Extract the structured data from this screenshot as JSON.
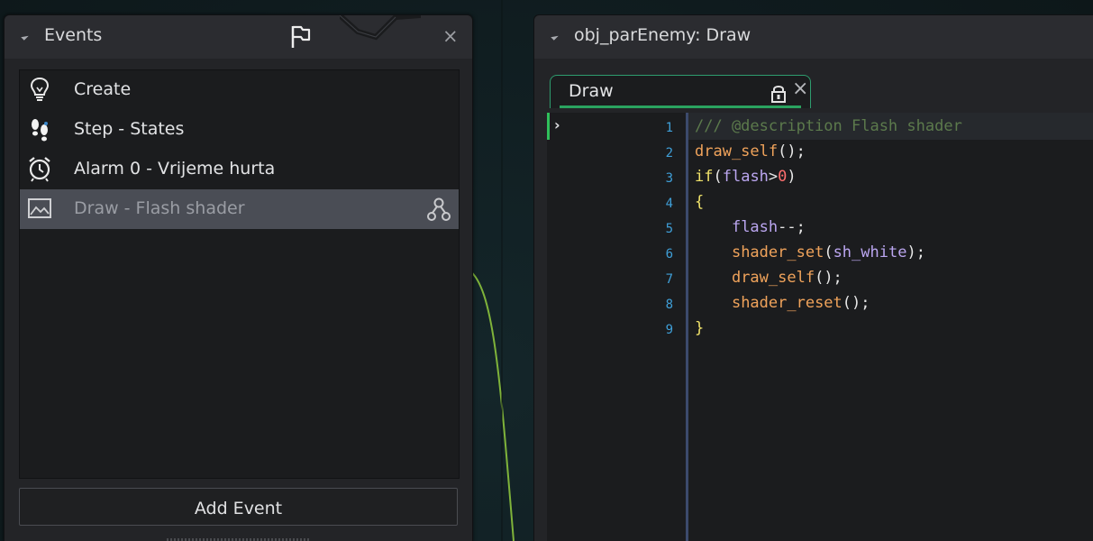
{
  "events_panel": {
    "title": "Events",
    "close_glyph": "×",
    "events": [
      {
        "label": "Create",
        "icon": "lightbulb-icon"
      },
      {
        "label": "Step - States",
        "icon": "footsteps-icon"
      },
      {
        "label": "Alarm 0 - Vrijeme hurta",
        "icon": "alarm-clock-icon"
      },
      {
        "label": "Draw - Flash shader",
        "icon": "picture-icon",
        "selected": true,
        "inherited": true
      }
    ],
    "add_event_label": "Add Event"
  },
  "code_panel": {
    "title": "obj_parEnemy: Draw",
    "tab": {
      "label": "Draw",
      "close_glyph": "×"
    },
    "run_marker": "›",
    "line_numbers": [
      "1",
      "2",
      "3",
      "4",
      "5",
      "6",
      "7",
      "8",
      "9"
    ],
    "lines": [
      [
        {
          "t": "/// @description Flash shader",
          "c": "comment"
        }
      ],
      [
        {
          "t": "draw_self",
          "c": "fn"
        },
        {
          "t": "();",
          "c": "punc"
        }
      ],
      [
        {
          "t": "if",
          "c": "kw"
        },
        {
          "t": "(",
          "c": "punc"
        },
        {
          "t": "flash",
          "c": "var"
        },
        {
          "t": ">",
          "c": "punc"
        },
        {
          "t": "0",
          "c": "num"
        },
        {
          "t": ")",
          "c": "punc"
        }
      ],
      [
        {
          "t": "{",
          "c": "brace"
        }
      ],
      [
        {
          "t": "    ",
          "c": "punc"
        },
        {
          "t": "flash",
          "c": "var"
        },
        {
          "t": "--;",
          "c": "punc"
        }
      ],
      [
        {
          "t": "    ",
          "c": "punc"
        },
        {
          "t": "shader_set",
          "c": "fn"
        },
        {
          "t": "(",
          "c": "punc"
        },
        {
          "t": "sh_white",
          "c": "var"
        },
        {
          "t": ");",
          "c": "punc"
        }
      ],
      [
        {
          "t": "    ",
          "c": "punc"
        },
        {
          "t": "draw_self",
          "c": "fn"
        },
        {
          "t": "();",
          "c": "punc"
        }
      ],
      [
        {
          "t": "    ",
          "c": "punc"
        },
        {
          "t": "shader_reset",
          "c": "fn"
        },
        {
          "t": "();",
          "c": "punc"
        }
      ],
      [
        {
          "t": "}",
          "c": "brace"
        }
      ]
    ]
  },
  "colors": {
    "accent_green": "#2aa35f",
    "line_number": "#3f9fd8",
    "comment": "#5c7a4c",
    "function": "#f0a35b",
    "keyword": "#f0e26a",
    "variable": "#bba6f0",
    "number": "#ff6f6f"
  }
}
